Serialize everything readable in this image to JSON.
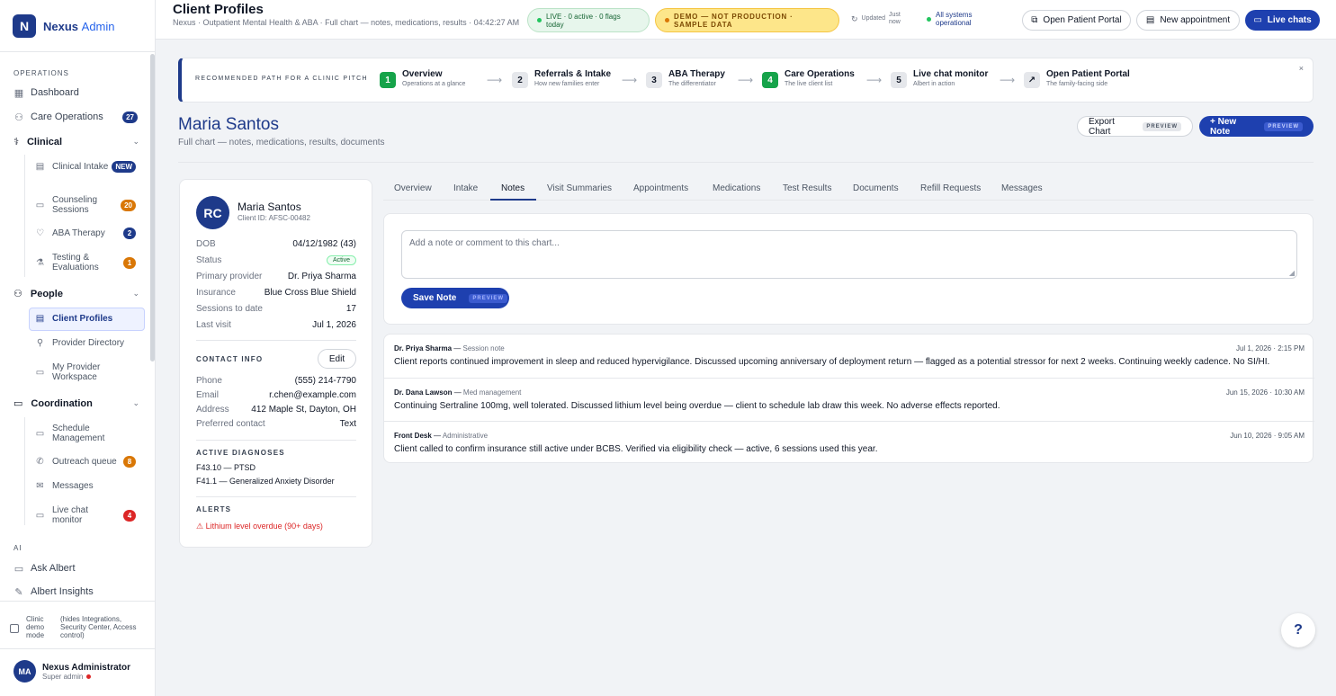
{
  "brand": {
    "mark": "N",
    "name": "Nexus",
    "suffix": "Admin"
  },
  "sidebar": {
    "sections": {
      "operations": "OPERATIONS",
      "ai": "AI"
    },
    "top_items": [
      {
        "label": "Dashboard",
        "icon": "grid-icon"
      },
      {
        "label": "Care Operations",
        "icon": "users-icon",
        "badge": "27"
      }
    ],
    "clinical": {
      "label": "Clinical",
      "items": [
        {
          "label": "Clinical Intake",
          "badge": "NEW"
        },
        {
          "label": "Counseling Sessions",
          "badge": "20"
        },
        {
          "label": "ABA Therapy",
          "badge": "2"
        },
        {
          "label": "Testing & Evaluations",
          "badge": "1"
        }
      ]
    },
    "people": {
      "label": "People",
      "items": [
        {
          "label": "Client Profiles"
        },
        {
          "label": "Provider Directory"
        },
        {
          "label": "My Provider Workspace"
        }
      ]
    },
    "coordination": {
      "label": "Coordination",
      "items": [
        {
          "label": "Schedule Management"
        },
        {
          "label": "Outreach queue",
          "badge": "8"
        },
        {
          "label": "Messages"
        },
        {
          "label": "Live chat monitor",
          "badge": "4"
        }
      ]
    },
    "ai_items": [
      {
        "label": "Ask Albert"
      },
      {
        "label": "Albert Insights"
      }
    ],
    "demo": {
      "label": "Clinic demo mode",
      "note": "(hides Integrations, Security Center, Access control)"
    },
    "user": {
      "initials": "MA",
      "name": "Nexus Administrator",
      "role": "Super admin"
    }
  },
  "topbar": {
    "title": "Client Profiles",
    "breadcrumb": "Nexus · Outpatient Mental Health & ABA · Full chart — notes, medications, results · 04:42:27 AM",
    "live": "LIVE · 0 active · 0 flags today",
    "demo": "DEMO — NOT PRODUCTION · SAMPLE DATA",
    "updated_label": "Updated",
    "updated_value": "Just now",
    "system": "All systems operational",
    "buttons": {
      "portal": "Open Patient Portal",
      "appointment": "New appointment",
      "chats": "Live chats"
    }
  },
  "path": {
    "label": "RECOMMENDED PATH FOR A CLINIC PITCH",
    "close": "×",
    "steps": [
      {
        "num": "1",
        "title": "Overview",
        "sub": "Operations at a glance"
      },
      {
        "num": "2",
        "title": "Referrals & Intake",
        "sub": "How new families enter"
      },
      {
        "num": "3",
        "title": "ABA Therapy",
        "sub": "The differentiator"
      },
      {
        "num": "4",
        "title": "Care Operations",
        "sub": "The live client list"
      },
      {
        "num": "5",
        "title": "Live chat monitor",
        "sub": "Albert in action"
      },
      {
        "num": "↗",
        "title": "Open Patient Portal",
        "sub": "The family-facing side"
      }
    ]
  },
  "patient": {
    "name": "Maria Santos",
    "subtitle": "Full chart — notes, medications, results, documents",
    "export_label": "Export Chart",
    "new_note_label": "+ New Note",
    "preview_tag": "PREVIEW",
    "initials": "RC",
    "client_id": "Client ID: AFSC-00482",
    "fields": [
      {
        "k": "DOB",
        "v": "04/12/1982 (43)"
      },
      {
        "k": "Status",
        "v": "Active"
      },
      {
        "k": "Primary provider",
        "v": "Dr. Priya Sharma"
      },
      {
        "k": "Insurance",
        "v": "Blue Cross Blue Shield"
      },
      {
        "k": "Sessions to date",
        "v": "17"
      },
      {
        "k": "Last visit",
        "v": "Jul 1, 2026"
      }
    ],
    "contact_label": "CONTACT INFO",
    "edit_label": "Edit",
    "contact": [
      {
        "k": "Phone",
        "v": "(555) 214-7790"
      },
      {
        "k": "Email",
        "v": "r.chen@example.com"
      },
      {
        "k": "Address",
        "v": "412 Maple St, Dayton, OH"
      },
      {
        "k": "Preferred contact",
        "v": "Text"
      }
    ],
    "diagnoses_label": "ACTIVE DIAGNOSES",
    "diagnoses": [
      "F43.10 — PTSD",
      "F41.1 — Generalized Anxiety Disorder"
    ],
    "alerts_label": "ALERTS",
    "alert": "⚠ Lithium level overdue (90+ days)"
  },
  "tabs": [
    "Overview",
    "Intake",
    "Notes",
    "Visit Summaries",
    "Appointments",
    "Medications",
    "Test Results",
    "Documents",
    "Refill Requests",
    "Messages"
  ],
  "composer": {
    "placeholder": "Add a note or comment to this chart...",
    "save_label": "Save Note"
  },
  "notes": [
    {
      "author": "Dr. Priya Sharma",
      "type": "Session note",
      "time": "Jul 1, 2026 · 2:15 PM",
      "body": "Client reports continued improvement in sleep and reduced hypervigilance. Discussed upcoming anniversary of deployment return — flagged as a potential stressor for next 2 weeks. Continuing weekly cadence. No SI/HI."
    },
    {
      "author": "Dr. Dana Lawson",
      "type": "Med management",
      "time": "Jun 15, 2026 · 10:30 AM",
      "body": "Continuing Sertraline 100mg, well tolerated. Discussed lithium level being overdue — client to schedule lab draw this week. No adverse effects reported."
    },
    {
      "author": "Front Desk",
      "type": "Administrative",
      "time": "Jun 10, 2026 · 9:05 AM",
      "body": "Client called to confirm insurance still active under BCBS. Verified via eligibility check — active, 6 sessions used this year."
    }
  ],
  "help": "?"
}
